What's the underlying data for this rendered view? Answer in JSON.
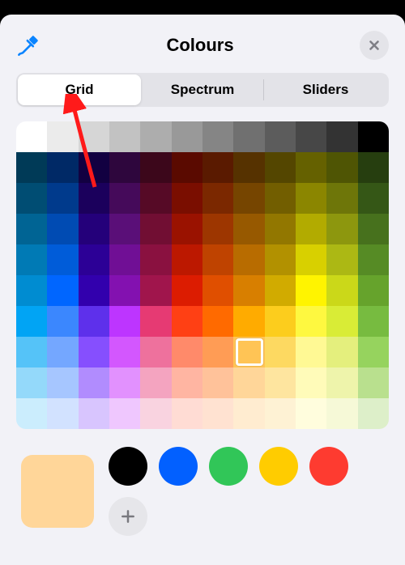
{
  "header": {
    "title": "Colours"
  },
  "tabs": {
    "items": [
      {
        "label": "Grid",
        "active": true
      },
      {
        "label": "Spectrum",
        "active": false
      },
      {
        "label": "Sliders",
        "active": false
      }
    ]
  },
  "grid": {
    "cols": 12,
    "rows": 10,
    "selected": {
      "row": 7,
      "col": 7
    },
    "colors": [
      [
        "#ffffff",
        "#ebebeb",
        "#d6d6d6",
        "#c2c2c2",
        "#adadad",
        "#999999",
        "#858585",
        "#707070",
        "#5c5c5c",
        "#474747",
        "#333333",
        "#000000"
      ],
      [
        "#003a57",
        "#002966",
        "#120041",
        "#2e063d",
        "#3c071b",
        "#5a0a00",
        "#5a1a00",
        "#563200",
        "#544600",
        "#656100",
        "#4f5504",
        "#263e0f"
      ],
      [
        "#004d73",
        "#003a8c",
        "#1b005c",
        "#450a5a",
        "#560a26",
        "#7a0e00",
        "#7b2800",
        "#764500",
        "#725e00",
        "#8b8600",
        "#6e7609",
        "#355716"
      ],
      [
        "#006494",
        "#004bb3",
        "#24007a",
        "#5a0f78",
        "#710e33",
        "#9a1200",
        "#9d3600",
        "#975900",
        "#927700",
        "#b2ab00",
        "#8d970e",
        "#47711d"
      ],
      [
        "#007ab5",
        "#005cd9",
        "#2c0096",
        "#700f95",
        "#8a1140",
        "#bc1800",
        "#bf4300",
        "#b86c00",
        "#b29100",
        "#d8d000",
        "#acb814",
        "#568b25"
      ],
      [
        "#008cd1",
        "#0066ff",
        "#3200ad",
        "#8311b0",
        "#a0154c",
        "#dc1c01",
        "#e04f00",
        "#d87f00",
        "#d1ab00",
        "#fff400",
        "#cbd819",
        "#66a32c"
      ],
      [
        "#01a4f4",
        "#3b87fe",
        "#5e30eb",
        "#bd35ff",
        "#e63a73",
        "#ff4014",
        "#ff6a00",
        "#ffab00",
        "#fccd1d",
        "#fef840",
        "#d9ec36",
        "#77bb40"
      ],
      [
        "#55c3f8",
        "#74a7ff",
        "#864ffe",
        "#d357fe",
        "#ee719d",
        "#ff8a6a",
        "#ff9c55",
        "#ffc455",
        "#fdd961",
        "#fff994",
        "#e4ef7d",
        "#96d35e"
      ],
      [
        "#94d9fa",
        "#a6c6ff",
        "#b18cfe",
        "#e291fe",
        "#f4a4c0",
        "#ffb5a2",
        "#ffc29a",
        "#ffd699",
        "#fee59f",
        "#fffbb9",
        "#eef4ab",
        "#b9e08e"
      ],
      [
        "#cbedfd",
        "#d2e2ff",
        "#d8c5fe",
        "#efc7fe",
        "#f9d3e0",
        "#ffdcd4",
        "#ffe2d1",
        "#ffecd0",
        "#fef2d4",
        "#fffddd",
        "#f6f9d7",
        "#ddefc9"
      ]
    ]
  },
  "current_color": "#ffd699",
  "presets": [
    "#000000",
    "#0260ff",
    "#31c658",
    "#ffcc00",
    "#fe3b30"
  ],
  "annotation": {
    "arrow_target": "tab-grid"
  }
}
